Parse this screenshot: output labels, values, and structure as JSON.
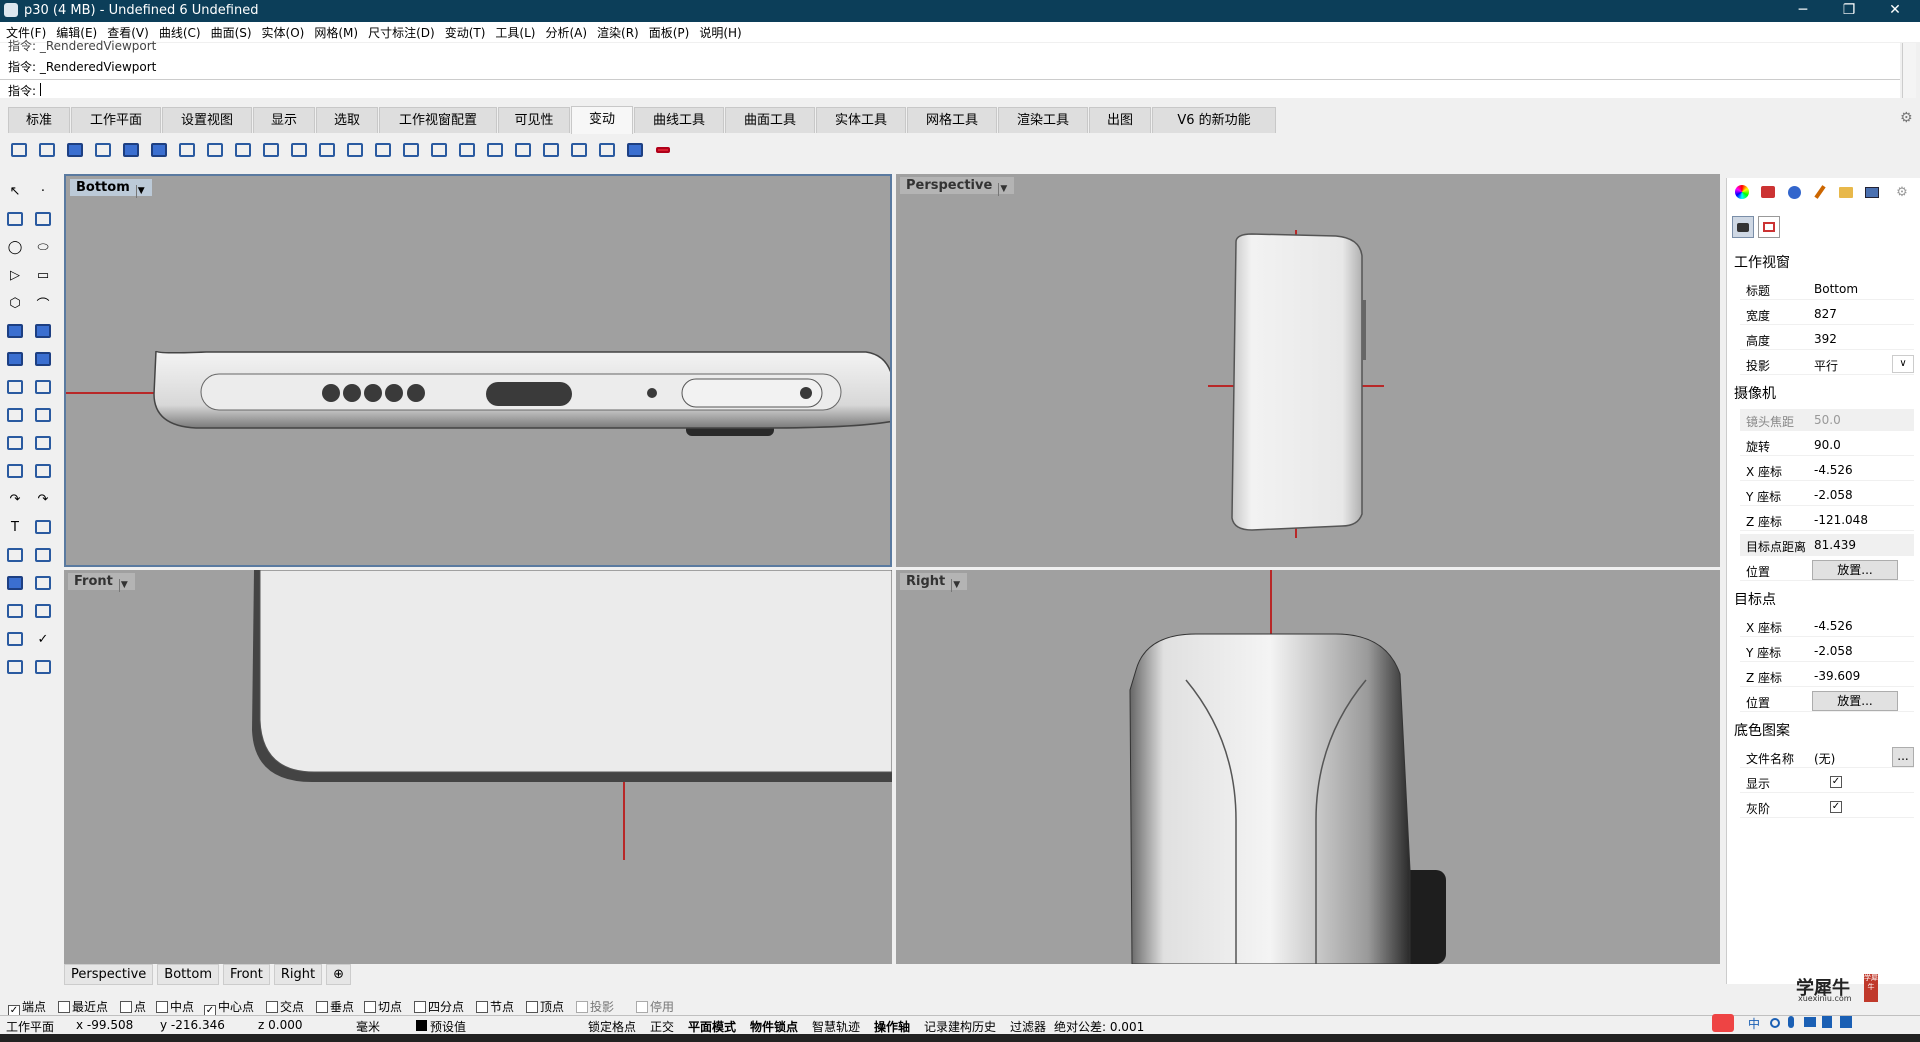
{
  "window": {
    "title": "p30 (4 MB) - Undefined 6 Undefined",
    "min": "─",
    "max": "❐",
    "close": "✕"
  },
  "menu": [
    "文件(F)",
    "编辑(E)",
    "查看(V)",
    "曲线(C)",
    "曲面(S)",
    "实体(O)",
    "网格(M)",
    "尺寸标注(D)",
    "变动(T)",
    "工具(L)",
    "分析(A)",
    "渲染(R)",
    "面板(P)",
    "说明(H)"
  ],
  "command": {
    "history_top": "指令: _RenderedViewport",
    "history": "指令: _RenderedViewport",
    "prompt": "指令:"
  },
  "tabs": [
    "标准",
    "工作平面",
    "设置视图",
    "显示",
    "选取",
    "工作视窗配置",
    "可见性",
    "变动",
    "曲线工具",
    "曲面工具",
    "实体工具",
    "网格工具",
    "渲染工具",
    "出图",
    "V6 的新功能"
  ],
  "active_tab": "变动",
  "viewports": {
    "bottom": {
      "label": "Bottom",
      "active": true
    },
    "perspective": {
      "label": "Perspective"
    },
    "front": {
      "label": "Front"
    },
    "right": {
      "label": "Right"
    }
  },
  "viewport_tabs": [
    "Perspective",
    "Bottom",
    "Front",
    "Right",
    "⊕"
  ],
  "osnaps": [
    {
      "label": "端点",
      "checked": true
    },
    {
      "label": "最近点",
      "checked": false
    },
    {
      "label": "点",
      "checked": false
    },
    {
      "label": "中点",
      "checked": false
    },
    {
      "label": "中心点",
      "checked": true
    },
    {
      "label": "交点",
      "checked": false
    },
    {
      "label": "垂点",
      "checked": false
    },
    {
      "label": "切点",
      "checked": false
    },
    {
      "label": "四分点",
      "checked": false
    },
    {
      "label": "节点",
      "checked": false
    },
    {
      "label": "顶点",
      "checked": false
    },
    {
      "label": "投影",
      "checked": false
    },
    {
      "label": "停用",
      "checked": false
    }
  ],
  "status": {
    "cplane": "工作平面",
    "x": "x -99.508",
    "y": "y -216.346",
    "z": "z 0.000",
    "unit": "毫米",
    "layer": "预设值",
    "grid_snap": "锁定格点",
    "ortho": "正交",
    "planar": "平面模式",
    "osnap": "物件锁点",
    "smarttrack": "智慧轨迹",
    "gumball": "操作轴",
    "history": "记录建构历史",
    "filter": "过滤器",
    "tolerance": "绝对公差: 0.001"
  },
  "panel": {
    "section_viewport": "工作视窗",
    "viewport_rows": [
      {
        "k": "标题",
        "v": "Bottom"
      },
      {
        "k": "宽度",
        "v": "827"
      },
      {
        "k": "高度",
        "v": "392"
      },
      {
        "k": "投影",
        "v": "平行"
      }
    ],
    "section_camera": "摄像机",
    "camera_rows": [
      {
        "k": "镜头焦距",
        "v": "50.0"
      },
      {
        "k": "旋转",
        "v": "90.0"
      },
      {
        "k": "X 座标",
        "v": "-4.526"
      },
      {
        "k": "Y 座标",
        "v": "-2.058"
      },
      {
        "k": "Z 座标",
        "v": "-121.048"
      },
      {
        "k": "目标点距离",
        "v": "81.439"
      }
    ],
    "position_label": "位置",
    "place_button": "放置...",
    "section_target": "目标点",
    "target_rows": [
      {
        "k": "X 座标",
        "v": "-4.526"
      },
      {
        "k": "Y 座标",
        "v": "-2.058"
      },
      {
        "k": "Z 座标",
        "v": "-39.609"
      }
    ],
    "section_wallpaper": "底色图案",
    "file_label": "文件名称",
    "file_value": "(无)",
    "browse": "...",
    "show_label": "显示",
    "gray_label": "灰阶"
  },
  "watermark": {
    "main": "学犀牛",
    "url": "xuexiniu.com",
    "seal": "学犀牛"
  },
  "tray": {
    "ime": "中"
  },
  "colors": {
    "titlebar": "#0c3e59",
    "viewport_bg": "#a0a0a0",
    "axis_red": "#c00000"
  }
}
